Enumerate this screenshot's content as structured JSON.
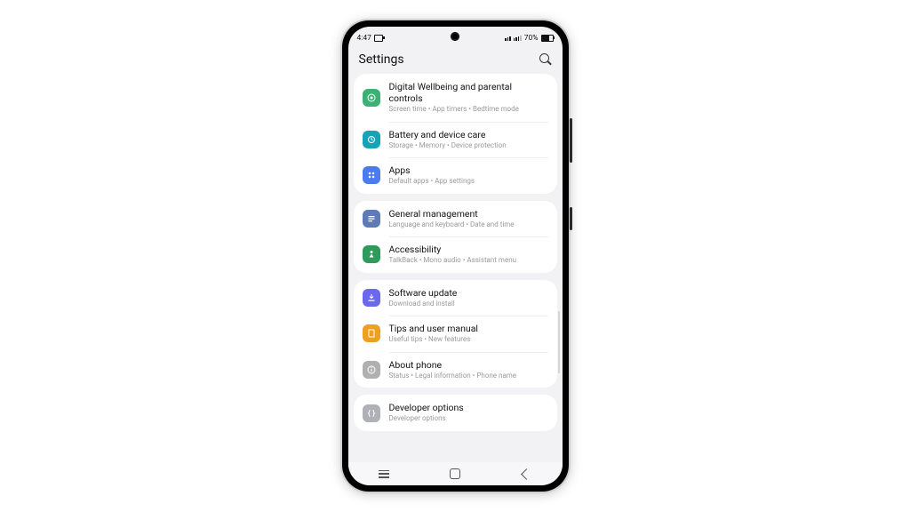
{
  "status": {
    "time": "4:47",
    "battery_pct": "70%"
  },
  "header": {
    "title": "Settings"
  },
  "groups": [
    {
      "items": [
        {
          "name": "digital-wellbeing",
          "color": "green",
          "icon": "target",
          "label": "Digital Wellbeing and parental controls",
          "sub": "Screen time  •  App timers  •  Bedtime mode"
        },
        {
          "name": "battery-device-care",
          "color": "teal",
          "icon": "care",
          "label": "Battery and device care",
          "sub": "Storage  •  Memory  •  Device protection"
        },
        {
          "name": "apps",
          "color": "blue",
          "icon": "grid",
          "label": "Apps",
          "sub": "Default apps  •  App settings"
        }
      ]
    },
    {
      "items": [
        {
          "name": "general-management",
          "color": "slate",
          "icon": "lines",
          "label": "General management",
          "sub": "Language and keyboard  •  Date and time"
        },
        {
          "name": "accessibility",
          "color": "green2",
          "icon": "person",
          "label": "Accessibility",
          "sub": "TalkBack  •  Mono audio  •  Assistant menu"
        }
      ]
    },
    {
      "items": [
        {
          "name": "software-update",
          "color": "purple",
          "icon": "download",
          "label": "Software update",
          "sub": "Download and install"
        },
        {
          "name": "tips-user-manual",
          "color": "orange",
          "icon": "book",
          "label": "Tips and user manual",
          "sub": "Useful tips  •  New features"
        },
        {
          "name": "about-phone",
          "color": "gray",
          "icon": "info",
          "label": "About phone",
          "sub": "Status  •  Legal information  •  Phone name"
        }
      ]
    },
    {
      "items": [
        {
          "name": "developer-options",
          "color": "gray2",
          "icon": "braces",
          "label": "Developer options",
          "sub": "Developer options",
          "highlighted": true
        }
      ]
    }
  ]
}
